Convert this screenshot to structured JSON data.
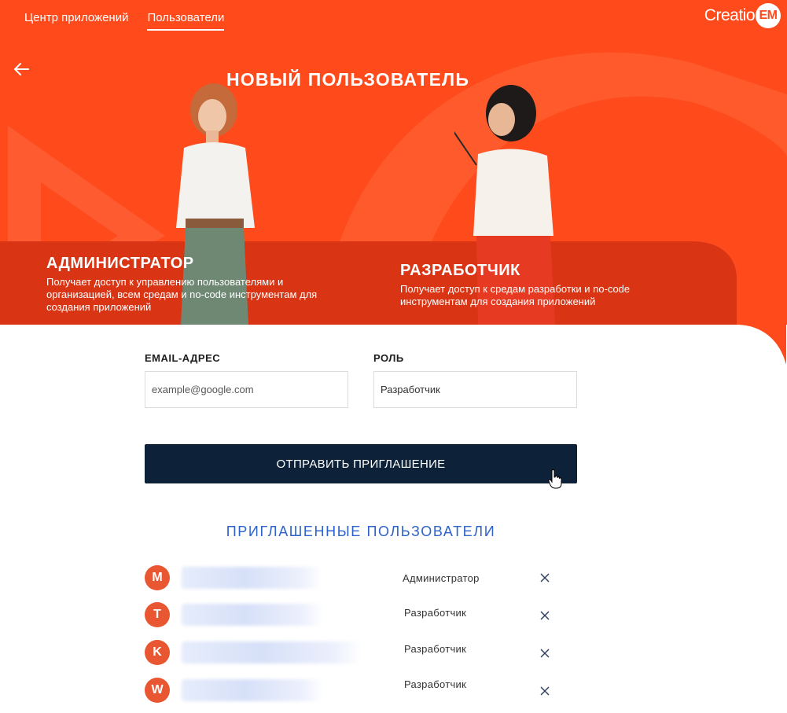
{
  "nav": {
    "tabs": [
      {
        "label": "Центр приложений",
        "active": false
      },
      {
        "label": "Пользователи",
        "active": true
      }
    ]
  },
  "logo": {
    "text": "Creatio",
    "badge": "EM"
  },
  "header": {
    "title": "НОВЫЙ ПОЛЬЗОВАТЕЛЬ"
  },
  "roles_cards": [
    {
      "title": "АДМИНИСТРАТОР",
      "description": "Получает доступ к управлению пользователями и организацией, всем средам и no-code инструментам для создания приложений"
    },
    {
      "title": "РАЗРАБОТЧИК",
      "description": "Получает доступ к средам разработки и no-code инструментам для создания приложений"
    }
  ],
  "form": {
    "email_label": "EMAIL-АДРЕС",
    "email_placeholder": "example@google.com",
    "role_label": "РОЛЬ",
    "role_value": "Разработчик",
    "submit_label": "ОТПРАВИТЬ ПРИГЛАШЕНИЕ"
  },
  "invited": {
    "title": "ПРИГЛАШЕННЫЕ ПОЛЬЗОВАТЕЛИ",
    "users": [
      {
        "initial": "M",
        "role": "Администратор"
      },
      {
        "initial": "T",
        "role": "Разработчик"
      },
      {
        "initial": "K",
        "role": "Разработчик"
      },
      {
        "initial": "W",
        "role": "Разработчик"
      }
    ]
  },
  "colors": {
    "brand_orange": "#ff4a1c",
    "button_navy": "#0d2139",
    "accent_blue": "#2e63c9",
    "avatar_orange": "#e85632"
  },
  "icons": [
    "back-arrow-icon",
    "close-icon",
    "hand-pointer-icon"
  ]
}
